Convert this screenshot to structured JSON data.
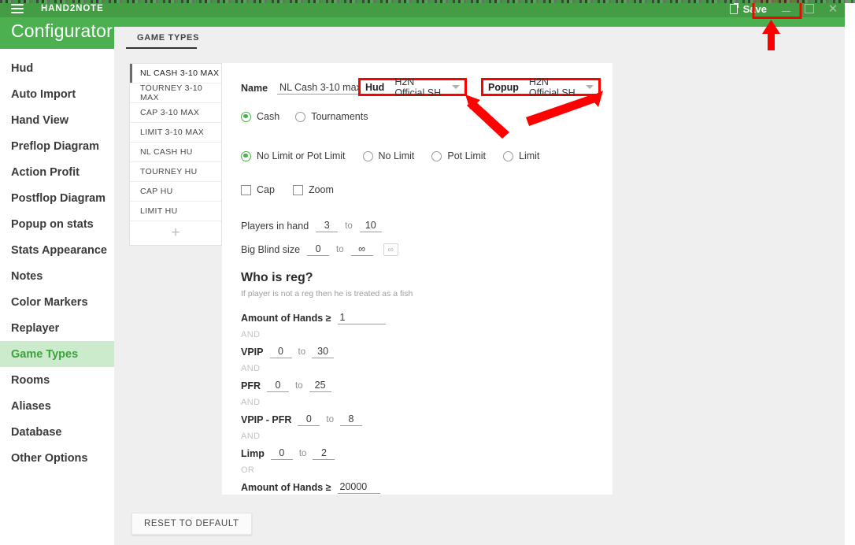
{
  "titlebar": {
    "app_name": "HAND2NOTE",
    "menu_icon": "hamburger-icon",
    "save_label": "Save",
    "save_icon": "save-file-icon",
    "minimize_icon": "minimize-icon",
    "maximize_icon": "maximize-icon",
    "close_icon": "close-icon"
  },
  "header": {
    "title": "Configurator",
    "accent_green": "#4caf50",
    "titlebar_green": "#449c44"
  },
  "tabs": [
    {
      "label": "GAME TYPES",
      "active": true
    }
  ],
  "sidebar": {
    "items": [
      {
        "label": "Hud",
        "active": false
      },
      {
        "label": "Auto Import",
        "active": false
      },
      {
        "label": "Hand View",
        "active": false
      },
      {
        "label": "Preflop Diagram",
        "active": false
      },
      {
        "label": "Action Profit",
        "active": false
      },
      {
        "label": "Postflop Diagram",
        "active": false
      },
      {
        "label": "Popup on stats",
        "active": false
      },
      {
        "label": "Stats Appearance",
        "active": false
      },
      {
        "label": "Notes",
        "active": false
      },
      {
        "label": "Color Markers",
        "active": false
      },
      {
        "label": "Replayer",
        "active": false
      },
      {
        "label": "Game Types",
        "active": true
      },
      {
        "label": "Rooms",
        "active": false
      },
      {
        "label": "Aliases",
        "active": false
      },
      {
        "label": "Database",
        "active": false
      },
      {
        "label": "Other Options",
        "active": false
      }
    ],
    "active_text_color": "#3aa33a",
    "active_bg_color": "#ccebcc"
  },
  "game_type_list": {
    "items": [
      {
        "label": "NL CASH 3-10 MAX",
        "active": true
      },
      {
        "label": "TOURNEY 3-10 MAX",
        "active": false
      },
      {
        "label": "CAP 3-10 MAX",
        "active": false
      },
      {
        "label": "LIMIT 3-10 MAX",
        "active": false
      },
      {
        "label": "NL CASH HU",
        "active": false
      },
      {
        "label": "TOURNEY HU",
        "active": false
      },
      {
        "label": "CAP HU",
        "active": false
      },
      {
        "label": "LIMIT HU",
        "active": false
      }
    ],
    "add_label": "+"
  },
  "form": {
    "name_label": "Name",
    "name_value": "NL Cash 3-10 max",
    "hud_label": "Hud",
    "hud_value": "H2N Official SH",
    "popup_label": "Popup",
    "popup_value": "H2N Official SH",
    "caret_icon": "chevron-down-icon",
    "game_kind": [
      {
        "label": "Cash",
        "selected": true
      },
      {
        "label": "Tournaments",
        "selected": false
      }
    ],
    "limit_kind": [
      {
        "label": "No Limit or Pot Limit",
        "selected": true
      },
      {
        "label": "No Limit",
        "selected": false
      },
      {
        "label": "Pot Limit",
        "selected": false
      },
      {
        "label": "Limit",
        "selected": false
      }
    ],
    "checkboxes": [
      {
        "label": "Cap",
        "checked": false
      },
      {
        "label": "Zoom",
        "checked": false
      }
    ],
    "players_label": "Players in hand",
    "players_from": "3",
    "players_to": "10",
    "bb_label": "Big Blind size",
    "bb_from": "0",
    "bb_to": "∞",
    "bb_infinity_icon": "infinity-icon",
    "bb_infinity_glyph": "∞",
    "to_label": "to"
  },
  "reg": {
    "title": "Who is reg?",
    "subtitle": "If player is not a reg then he is treated as a fish",
    "rows": [
      {
        "kind": "single",
        "label": "Amount of Hands ≥",
        "value": "1"
      },
      {
        "kind": "conj",
        "label": "AND"
      },
      {
        "kind": "range",
        "label": "VPIP",
        "from": "0",
        "to": "30"
      },
      {
        "kind": "conj",
        "label": "AND"
      },
      {
        "kind": "range",
        "label": "PFR",
        "from": "0",
        "to": "25"
      },
      {
        "kind": "conj",
        "label": "AND"
      },
      {
        "kind": "range",
        "label": "VPIP - PFR",
        "from": "0",
        "to": "8"
      },
      {
        "kind": "conj",
        "label": "AND"
      },
      {
        "kind": "range",
        "label": "Limp",
        "from": "0",
        "to": "2"
      },
      {
        "kind": "conj",
        "label": "OR"
      },
      {
        "kind": "single",
        "label": "Amount of Hands ≥",
        "value": "20000"
      }
    ],
    "to_label": "to"
  },
  "footer": {
    "reset_label": "RESET TO DEFAULT"
  },
  "annotations": {
    "highlight_color": "#ff0000",
    "boxes": [
      "save-button",
      "hud-dropdown",
      "popup-dropdown"
    ],
    "arrows": [
      "arrow-to-save",
      "arrow-to-hud",
      "arrow-to-popup"
    ]
  }
}
